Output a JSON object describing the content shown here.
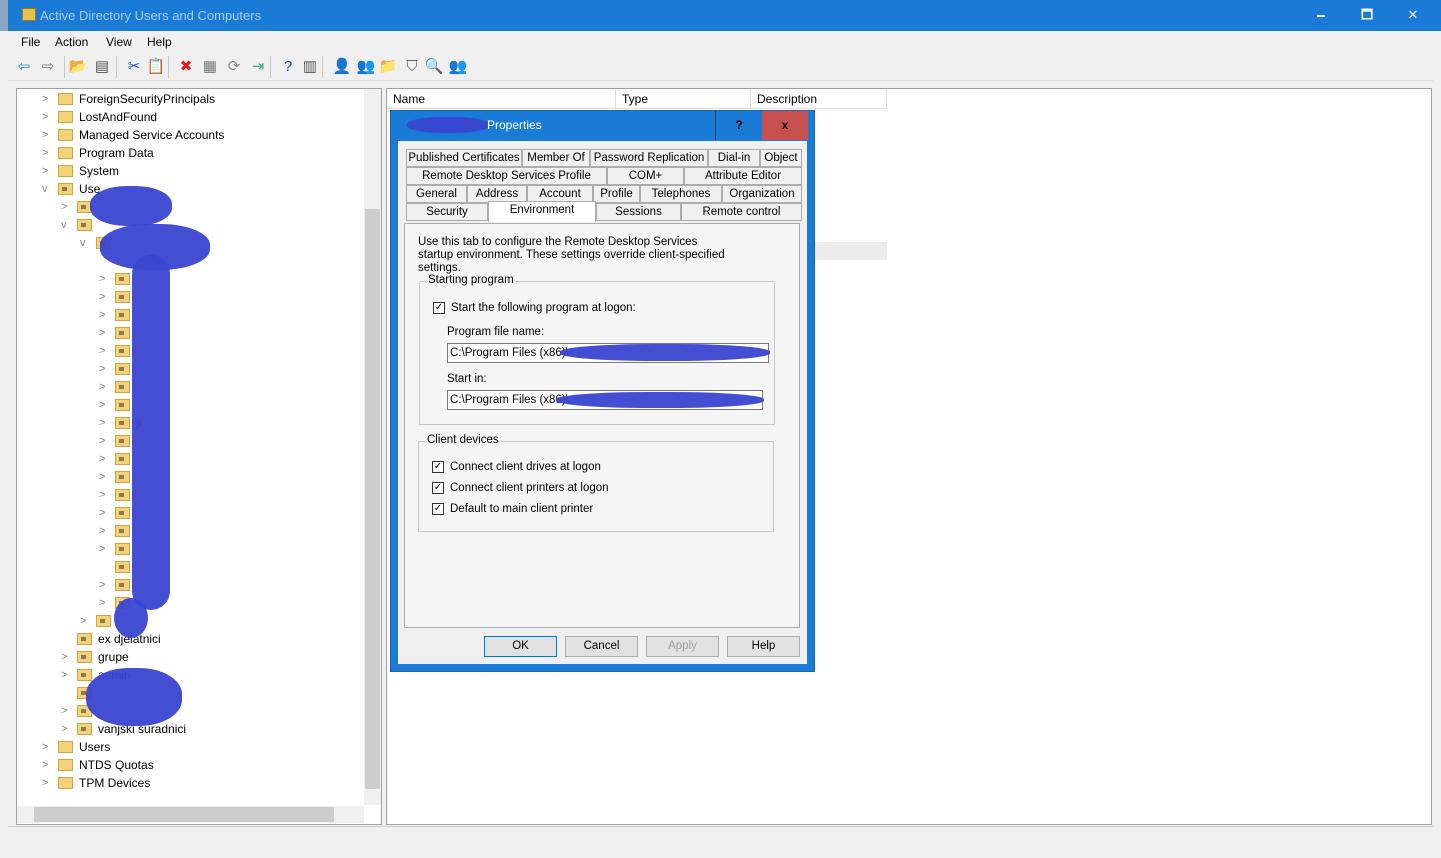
{
  "window": {
    "title": "Active Directory Users and Computers",
    "minimize": "🗕",
    "maximize": "🗖",
    "close": "✕"
  },
  "menu": [
    "File",
    "Action",
    "View",
    "Help"
  ],
  "toolbar": [
    "⇦",
    "⇨",
    "📂",
    "▤",
    "✂",
    "📋",
    "✖",
    "▦",
    "⟳",
    "⇥",
    "?",
    "▥",
    "👤",
    "👥",
    "📁",
    "⛉",
    "🔍",
    "👥"
  ],
  "tree": [
    {
      "label": "ForeignSecurityPrincipals",
      "level": 0,
      "chevron": ">",
      "type": "folder"
    },
    {
      "label": "LostAndFound",
      "level": 0,
      "chevron": ">",
      "type": "folder"
    },
    {
      "label": "Managed Service Accounts",
      "level": 0,
      "chevron": ">",
      "type": "folder"
    },
    {
      "label": "Program Data",
      "level": 0,
      "chevron": ">",
      "type": "folder"
    },
    {
      "label": "System",
      "level": 0,
      "chevron": ">",
      "type": "folder"
    },
    {
      "label": "Use",
      "level": 0,
      "chevron": "v",
      "type": "ou"
    },
    {
      "label": "",
      "level": 1,
      "chevron": ">",
      "type": "ou"
    },
    {
      "label": "",
      "level": 1,
      "chevron": "v",
      "type": "ou"
    },
    {
      "label": "",
      "level": 2,
      "chevron": "v",
      "type": "ou"
    },
    {
      "label": "",
      "level": 3,
      "chevron": "",
      "type": "none"
    },
    {
      "label": "",
      "level": 3,
      "chevron": ">",
      "type": "ou"
    },
    {
      "label": "",
      "level": 3,
      "chevron": ">",
      "type": "ou"
    },
    {
      "label": "",
      "level": 3,
      "chevron": ">",
      "type": "ou"
    },
    {
      "label": "",
      "level": 3,
      "chevron": ">",
      "type": "ou"
    },
    {
      "label": "",
      "level": 3,
      "chevron": ">",
      "type": "ou"
    },
    {
      "label": "",
      "level": 3,
      "chevron": ">",
      "type": "ou"
    },
    {
      "label": "",
      "level": 3,
      "chevron": ">",
      "type": "ou"
    },
    {
      "label": "",
      "level": 3,
      "chevron": ">",
      "type": "ou"
    },
    {
      "label": "ji",
      "level": 3,
      "chevron": ">",
      "type": "ou"
    },
    {
      "label": "",
      "level": 3,
      "chevron": ">",
      "type": "ou"
    },
    {
      "label": "",
      "level": 3,
      "chevron": ">",
      "type": "ou"
    },
    {
      "label": "",
      "level": 3,
      "chevron": ">",
      "type": "ou"
    },
    {
      "label": "",
      "level": 3,
      "chevron": ">",
      "type": "ou"
    },
    {
      "label": "",
      "level": 3,
      "chevron": ">",
      "type": "ou"
    },
    {
      "label": "",
      "level": 3,
      "chevron": ">",
      "type": "ou"
    },
    {
      "label": "",
      "level": 3,
      "chevron": ">",
      "type": "ou"
    },
    {
      "label": "",
      "level": 3,
      "chevron": "",
      "type": "ou"
    },
    {
      "label": "",
      "level": 3,
      "chevron": ">",
      "type": "ou"
    },
    {
      "label": "",
      "level": 3,
      "chevron": ">",
      "type": "ou"
    },
    {
      "label": "",
      "level": 2,
      "chevron": ">",
      "type": "ou"
    },
    {
      "label": "ex djelatnici",
      "level": 1,
      "chevron": "",
      "type": "ou"
    },
    {
      "label": "grupe",
      "level": 1,
      "chevron": ">",
      "type": "ou"
    },
    {
      "label": "admin",
      "level": 1,
      "chevron": ">",
      "type": "ou"
    },
    {
      "label": "",
      "level": 1,
      "chevron": "",
      "type": "ou"
    },
    {
      "label": "",
      "level": 1,
      "chevron": ">",
      "type": "ou"
    },
    {
      "label": "vanjski suradnici",
      "level": 1,
      "chevron": ">",
      "type": "ou"
    },
    {
      "label": "Users",
      "level": 0,
      "chevron": ">",
      "type": "folder"
    },
    {
      "label": "NTDS Quotas",
      "level": 0,
      "chevron": ">",
      "type": "folder"
    },
    {
      "label": "TPM Devices",
      "level": 0,
      "chevron": ">",
      "type": "folder"
    }
  ],
  "list": {
    "columns": [
      "Name",
      "Type",
      "Description"
    ]
  },
  "dialog": {
    "title": "Properties",
    "help": "?",
    "close": "x",
    "tabs_row1": [
      "Published Certificates",
      "Member Of",
      "Password Replication",
      "Dial-in",
      "Object"
    ],
    "tabs_row2": [
      "Remote Desktop Services Profile",
      "COM+",
      "Attribute Editor"
    ],
    "tabs_row3": [
      "General",
      "Address",
      "Account",
      "Profile",
      "Telephones",
      "Organization"
    ],
    "tabs_row4": [
      "Security",
      "Environment",
      "Sessions",
      "Remote control"
    ],
    "description": "Use this tab to configure the Remote Desktop Services startup environment. These settings override client-specified settings.",
    "starting_program": {
      "label": "Starting program",
      "checkbox": "Start the following program at logon:",
      "checked": true,
      "program_label": "Program file name:",
      "program_value": "C:\\Program Files (x86)\\",
      "startin_label": "Start in:",
      "startin_value": "C:\\Program Files (x86)\\"
    },
    "client_devices": {
      "label": "Client devices",
      "items": [
        {
          "label": "Connect client drives at logon",
          "checked": true
        },
        {
          "label": "Connect client printers at logon",
          "checked": true
        },
        {
          "label": "Default to main client printer",
          "checked": true
        }
      ]
    },
    "buttons": {
      "ok": "OK",
      "cancel": "Cancel",
      "apply": "Apply",
      "help": "Help"
    },
    "check": "✓"
  }
}
